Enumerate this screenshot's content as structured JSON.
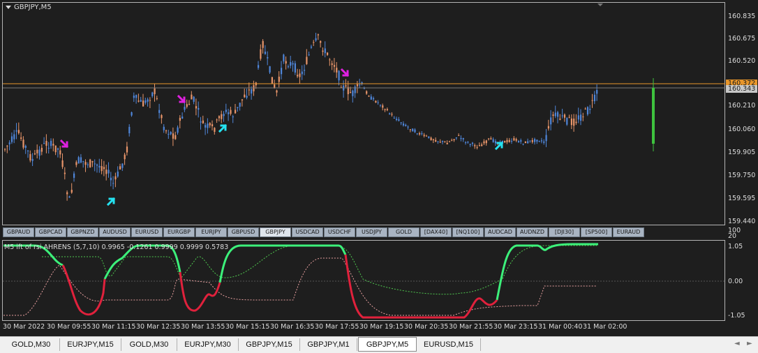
{
  "chart": {
    "title": "GBPJPY,M5",
    "price_labels": [
      "160.835",
      "160.675",
      "160.520",
      "160.365",
      "160.210",
      "160.060",
      "159.905",
      "159.750",
      "159.595",
      "159.440"
    ],
    "price_tag_orange": "160.372",
    "price_tag_gray": "160.343",
    "colors": {
      "bull": "#4f86d9",
      "bear": "#e8956a",
      "bid_line": "#e8962b",
      "arrow_up": "#25e2f0",
      "arrow_down": "#e020e0",
      "volume_bar": "#3ec23e"
    }
  },
  "symbols": [
    "GBPAUD",
    "GBPCAD",
    "GBPNZD",
    "AUDUSD",
    "EURUSD",
    "EURGBP",
    "EURJPY",
    "GBPUSD",
    "GBPJPY",
    "USDCAD",
    "USDCHF",
    "USDJPY",
    "GOLD",
    "[DAX40]",
    "[NQ100]",
    "AUDCAD",
    "AUDNZD",
    "[DJI30]",
    "[SP500]",
    "EURAUD"
  ],
  "active_symbol": "GBPJPY",
  "indicator": {
    "title": "M5 ift of rsi AHRENS (5,7,10) 0.9965 -0.1261 0.9999 0.9999 0.5783",
    "scale_top": "100",
    "scale_top2": "20",
    "levels": [
      "1.05",
      "0.00",
      "-1.05"
    ],
    "colors": {
      "up": "#3cf07a",
      "down": "#e0213c",
      "signal1": "#4fc94f",
      "signal2": "#e8a0a0"
    }
  },
  "time_labels": [
    "30 Mar 2022",
    "30 Mar 09:55",
    "30 Mar 11:15",
    "30 Mar 12:35",
    "30 Mar 13:55",
    "30 Mar 15:15",
    "30 Mar 16:35",
    "30 Mar 17:55",
    "30 Mar 19:15",
    "30 Mar 20:35",
    "30 Mar 21:55",
    "30 Mar 23:15",
    "31 Mar 00:40",
    "31 Mar 02:00"
  ],
  "tabs": [
    "GOLD,M30",
    "EURJPY,M15",
    "GOLD,M30",
    "EURJPY,M30",
    "GBPJPY,M15",
    "GBPJPY,M1",
    "GBPJPY,M5",
    "EURUSD,M15"
  ],
  "active_tab": "GBPJPY,M5",
  "tab_scroll": {
    "left": "◄",
    "right": "►"
  }
}
